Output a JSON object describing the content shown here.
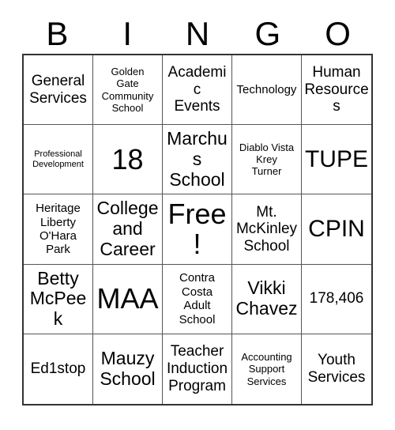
{
  "card": {
    "title": "BINGO",
    "free_space_label": "Free!",
    "colors": {
      "background": "#ffffff",
      "text": "#000000",
      "outer_border": "#333333",
      "inner_border": "#555555"
    },
    "header": {
      "letters": [
        {
          "label": "B"
        },
        {
          "label": "I"
        },
        {
          "label": "N"
        },
        {
          "label": "G"
        },
        {
          "label": "O"
        }
      ]
    },
    "grid": {
      "columns": 5,
      "rows": 5,
      "cells": [
        {
          "text": "General\nServices",
          "size": "fs-l"
        },
        {
          "text": "Golden\nGate\nCommunity\nSchool",
          "size": "fs-s"
        },
        {
          "text": "Academic\nEvents",
          "size": "fs-l"
        },
        {
          "text": "Technology",
          "size": "fs-m"
        },
        {
          "text": "Human\nResources",
          "size": "fs-l"
        },
        {
          "text": "Professional\nDevelopment",
          "size": "fs-xs"
        },
        {
          "text": "18",
          "size": "fs-huge"
        },
        {
          "text": "Marchus\nSchool",
          "size": "fs-xl"
        },
        {
          "text": "Diablo Vista\nKrey\nTurner",
          "size": "fs-s"
        },
        {
          "text": "TUPE",
          "size": "fs-xxl"
        },
        {
          "text": "Heritage\nLiberty\nO'Hara\nPark",
          "size": "fs-m"
        },
        {
          "text": "College\nand\nCareer",
          "size": "fs-xl"
        },
        {
          "text": "Free!",
          "size": "fs-huge"
        },
        {
          "text": "Mt.\nMcKinley\nSchool",
          "size": "fs-l"
        },
        {
          "text": "CPIN",
          "size": "fs-xxl"
        },
        {
          "text": "Betty\nMcPeek",
          "size": "fs-xl"
        },
        {
          "text": "MAA",
          "size": "fs-huge"
        },
        {
          "text": "Contra\nCosta\nAdult\nSchool",
          "size": "fs-m"
        },
        {
          "text": "Vikki\nChavez",
          "size": "fs-xl"
        },
        {
          "text": "178,406",
          "size": "fs-l"
        },
        {
          "text": "Ed1stop",
          "size": "fs-l"
        },
        {
          "text": "Mauzy\nSchool",
          "size": "fs-xl"
        },
        {
          "text": "Teacher\nInduction\nProgram",
          "size": "fs-l"
        },
        {
          "text": "Accounting\nSupport\nServices",
          "size": "fs-s"
        },
        {
          "text": "Youth\nServices",
          "size": "fs-l"
        }
      ]
    }
  }
}
